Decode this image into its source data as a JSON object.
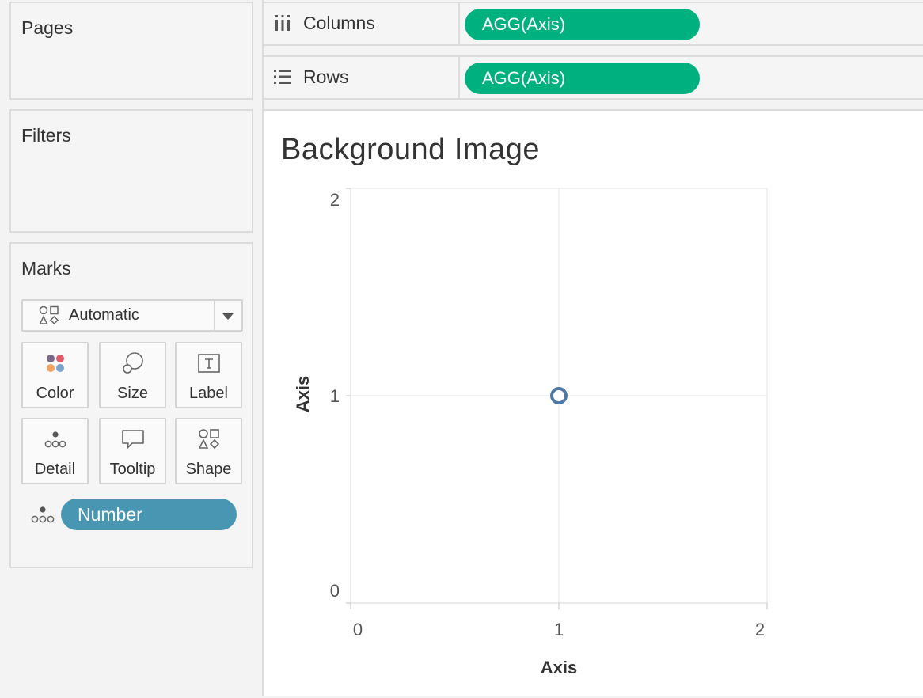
{
  "cards": {
    "pages_title": "Pages",
    "filters_title": "Filters",
    "marks_title": "Marks"
  },
  "shelves": {
    "columns": {
      "label": "Columns",
      "pill": "AGG(Axis)"
    },
    "rows": {
      "label": "Rows",
      "pill": "AGG(Axis)"
    }
  },
  "marks": {
    "mark_type": "Automatic",
    "buttons": {
      "color": "Color",
      "size": "Size",
      "label": "Label",
      "detail": "Detail",
      "tooltip": "Tooltip",
      "shape": "Shape"
    },
    "detail_pill": "Number"
  },
  "colors": {
    "column_row_pill": "#00b180",
    "detail_pill": "#4996b2",
    "mark_stroke": "#4e79a7"
  },
  "sheet": {
    "title": "Background Image"
  },
  "chart_data": {
    "type": "scatter",
    "title": "Background Image",
    "xlabel": "Axis",
    "ylabel": "Axis",
    "xlim": [
      0,
      2
    ],
    "ylim": [
      0,
      2
    ],
    "x_ticks": [
      "0",
      "1",
      "2"
    ],
    "y_ticks": [
      "0",
      "1",
      "2"
    ],
    "points": [
      {
        "x": 1,
        "y": 1
      }
    ],
    "grid": true,
    "marker": "open-circle"
  }
}
